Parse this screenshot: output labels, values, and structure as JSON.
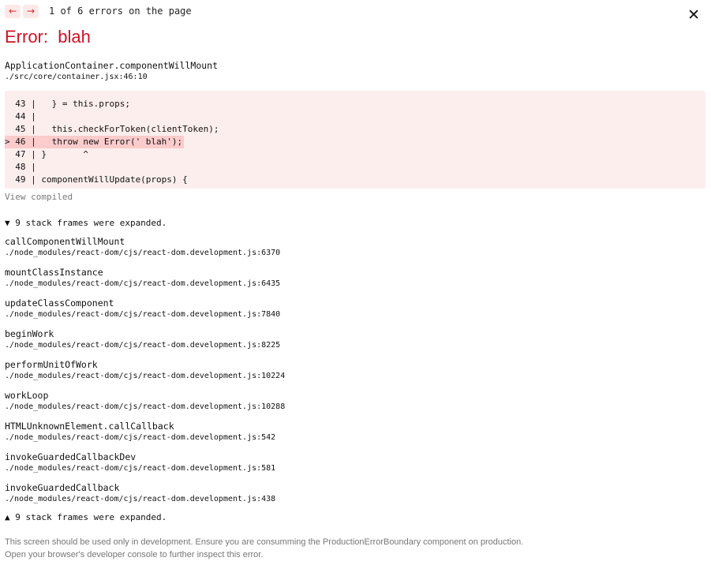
{
  "nav": {
    "prev_icon": "arrow-left-icon",
    "prev_glyph": "←",
    "next_icon": "arrow-right-icon",
    "next_glyph": "→",
    "status": "1 of 6 errors on the page",
    "close_glyph": "✕",
    "close_icon": "close-icon"
  },
  "error": {
    "title": "Error:  blah"
  },
  "origin": {
    "function": "ApplicationContainer.componentWillMount",
    "location": "./src/core/container.jsx:46:10"
  },
  "code": {
    "lines": [
      {
        "text": "  43 |   } = this.props;",
        "highlight": false
      },
      {
        "text": "  44 |",
        "highlight": false
      },
      {
        "text": "  45 |   this.checkForToken(clientToken);",
        "highlight": false
      },
      {
        "text": "> 46 |   throw new Error(' blah');",
        "highlight": true
      },
      {
        "text": "  47 | }       ^",
        "highlight": false
      },
      {
        "text": "  48 |",
        "highlight": false
      },
      {
        "text": "  49 | componentWillUpdate(props) {",
        "highlight": false
      }
    ]
  },
  "view_compiled": "View compiled",
  "toggle_top": "▼ 9 stack frames were expanded.",
  "toggle_bottom": "▲ 9 stack frames were expanded.",
  "frames": [
    {
      "function": "callComponentWillMount",
      "location": "./node_modules/react-dom/cjs/react-dom.development.js:6370"
    },
    {
      "function": "mountClassInstance",
      "location": "./node_modules/react-dom/cjs/react-dom.development.js:6435"
    },
    {
      "function": "updateClassComponent",
      "location": "./node_modules/react-dom/cjs/react-dom.development.js:7840"
    },
    {
      "function": "beginWork",
      "location": "./node_modules/react-dom/cjs/react-dom.development.js:8225"
    },
    {
      "function": "performUnitOfWork",
      "location": "./node_modules/react-dom/cjs/react-dom.development.js:10224"
    },
    {
      "function": "workLoop",
      "location": "./node_modules/react-dom/cjs/react-dom.development.js:10288"
    },
    {
      "function": "HTMLUnknownElement.callCallback",
      "location": "./node_modules/react-dom/cjs/react-dom.development.js:542"
    },
    {
      "function": "invokeGuardedCallbackDev",
      "location": "./node_modules/react-dom/cjs/react-dom.development.js:581"
    },
    {
      "function": "invokeGuardedCallback",
      "location": "./node_modules/react-dom/cjs/react-dom.development.js:438"
    }
  ],
  "footer": {
    "line1": "This screen should be used only in development. Ensure you are consumming the ProductionErrorBoundary component on production.",
    "line2": "Open your browser's developer console to further inspect this error."
  },
  "colors": {
    "error_red": "#ce1126",
    "code_bg": "#fdeeee",
    "highlight_bg": "#fccbcb",
    "nav_bg": "#fde8e8"
  }
}
